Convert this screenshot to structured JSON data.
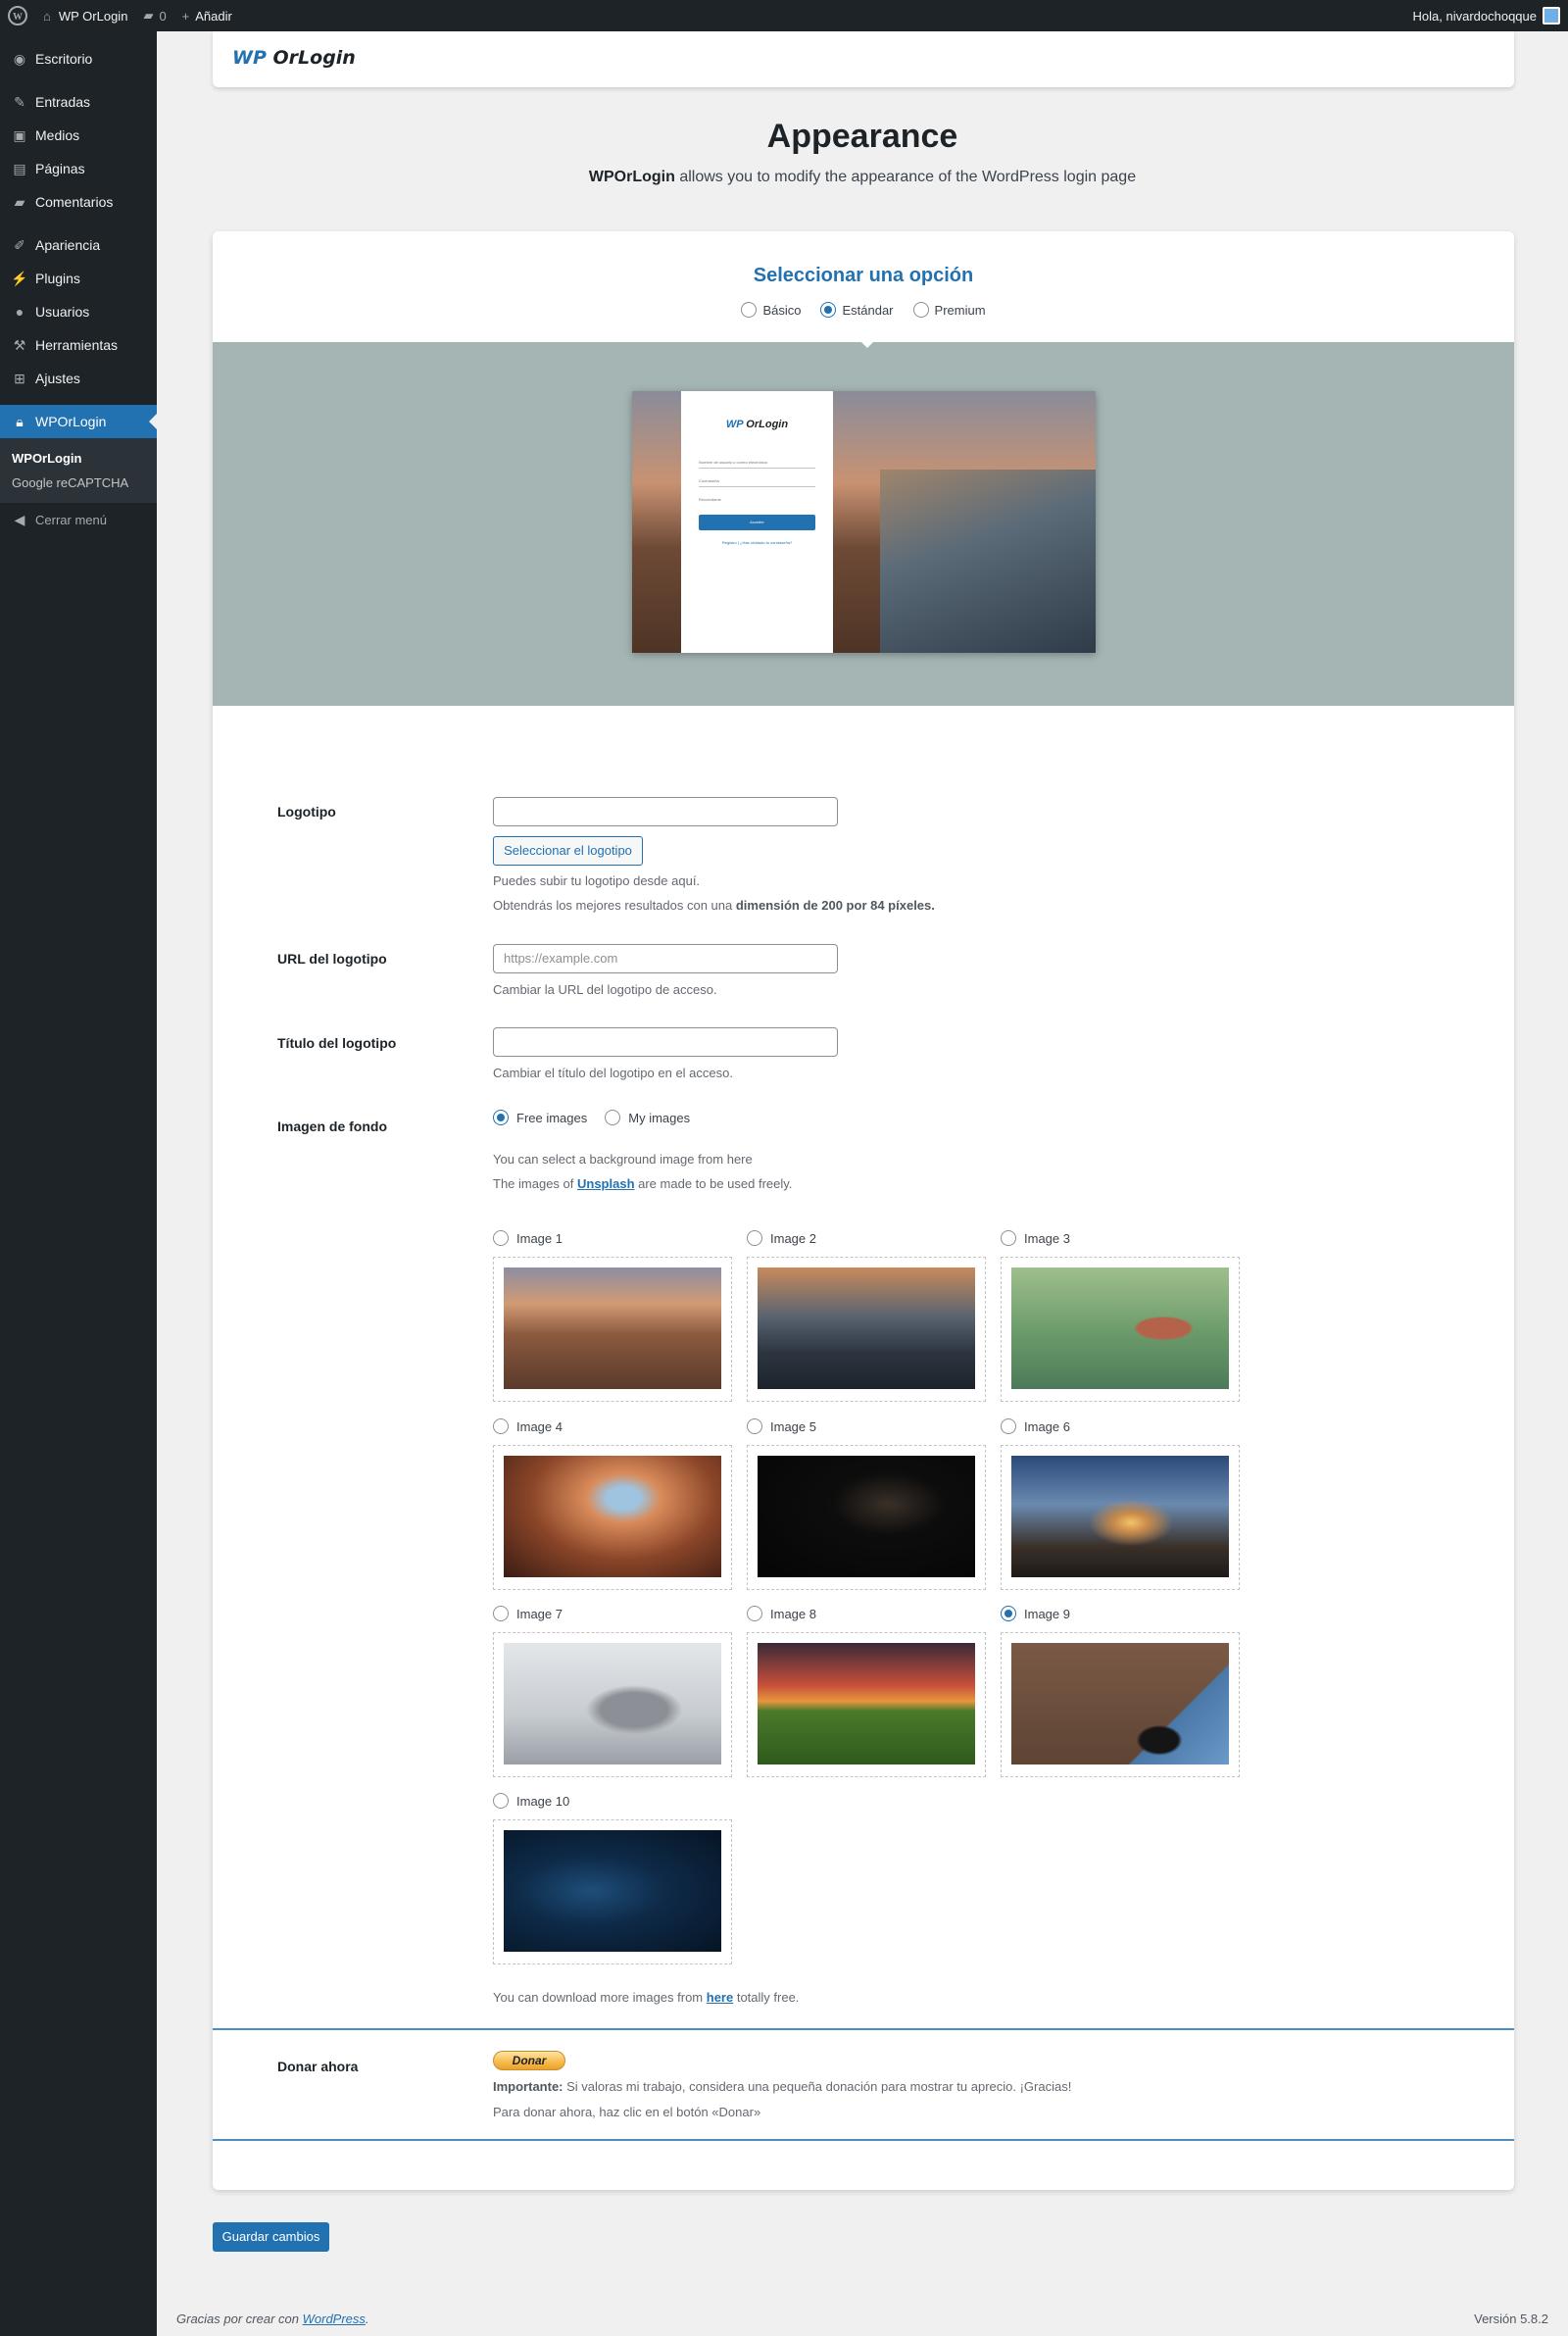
{
  "adminbar": {
    "site_name": "WP OrLogin",
    "comments_count": "0",
    "new_label": "Añadir",
    "greeting": "Hola, nivardochoqque"
  },
  "sidebar": {
    "items": [
      {
        "label": "Escritorio",
        "icon": "dashboard-icon"
      },
      {
        "label": "Entradas",
        "icon": "pin-icon"
      },
      {
        "label": "Medios",
        "icon": "media-icon"
      },
      {
        "label": "Páginas",
        "icon": "page-icon"
      },
      {
        "label": "Comentarios",
        "icon": "comment-icon"
      },
      {
        "label": "Apariencia",
        "icon": "brush-icon"
      },
      {
        "label": "Plugins",
        "icon": "plugin-icon"
      },
      {
        "label": "Usuarios",
        "icon": "user-icon"
      },
      {
        "label": "Herramientas",
        "icon": "wrench-icon"
      },
      {
        "label": "Ajustes",
        "icon": "settings-icon"
      },
      {
        "label": "WPOrLogin",
        "icon": "lock-icon"
      }
    ],
    "submenu": [
      "WPOrLogin",
      "Google reCAPTCHA"
    ],
    "collapse_label": "Cerrar menú"
  },
  "brand": {
    "wp": "WP",
    "name": "OrLogin"
  },
  "header": {
    "title": "Appearance",
    "subtitle_strong": "WPOrLogin",
    "subtitle_rest": " allows you to modify the appearance of the WordPress login page"
  },
  "options": {
    "title": "Seleccionar una opción",
    "choices": [
      "Básico",
      "Estándar",
      "Premium"
    ],
    "selected": "Estándar"
  },
  "preview": {
    "logo_wp": "WP",
    "logo_name": "OrLogin",
    "user_label": "Nombre de usuario o correo electrónico",
    "pass_label": "Contraseña",
    "remember_label": "Recuérdame",
    "button_label": "Acceder",
    "links": "Registro | ¿Has olvidado tu contraseña?"
  },
  "form": {
    "logo": {
      "label": "Logotipo",
      "value": "",
      "button": "Seleccionar el logotipo",
      "help1": "Puedes subir tu logotipo desde aquí.",
      "help2_pre": "Obtendrás los mejores resultados con una ",
      "help2_bold": "dimensión de 200 por 84 píxeles."
    },
    "logo_url": {
      "label": "URL del logotipo",
      "placeholder": "https://example.com",
      "help": "Cambiar la URL del logotipo de acceso."
    },
    "logo_title": {
      "label": "Título del logotipo",
      "value": "",
      "help": "Cambiar el título del logotipo en el acceso."
    },
    "background": {
      "label": "Imagen de fondo",
      "sources": [
        "Free images",
        "My images"
      ],
      "selected_source": "Free images",
      "help1": "You can select a background image from here",
      "help2_pre": "The images of ",
      "help2_link": "Unsplash",
      "help2_post": " are made to be used freely.",
      "images": [
        "Image 1",
        "Image 2",
        "Image 3",
        "Image 4",
        "Image 5",
        "Image 6",
        "Image 7",
        "Image 8",
        "Image 9",
        "Image 10"
      ],
      "selected_image": "Image 9",
      "more_pre": "You can download more images from ",
      "more_link": "here",
      "more_post": " totally free."
    },
    "donate": {
      "label": "Donar ahora",
      "button": "Donar",
      "important_label": "Importante:",
      "important_text": " Si valoras mi trabajo, considera una pequeña donación para mostrar tu aprecio. ¡Gracias!",
      "instruction": "Para donar ahora, haz clic en el botón «Donar»"
    }
  },
  "save_label": "Guardar cambios",
  "footer": {
    "thanks_pre": "Gracias por crear con ",
    "thanks_link": "WordPress",
    "thanks_post": ".",
    "version": "Versión 5.8.2"
  },
  "colors": {
    "accent": "#2271b1",
    "adminbar": "#1d2327",
    "preview_band": "#a4b5b3"
  }
}
